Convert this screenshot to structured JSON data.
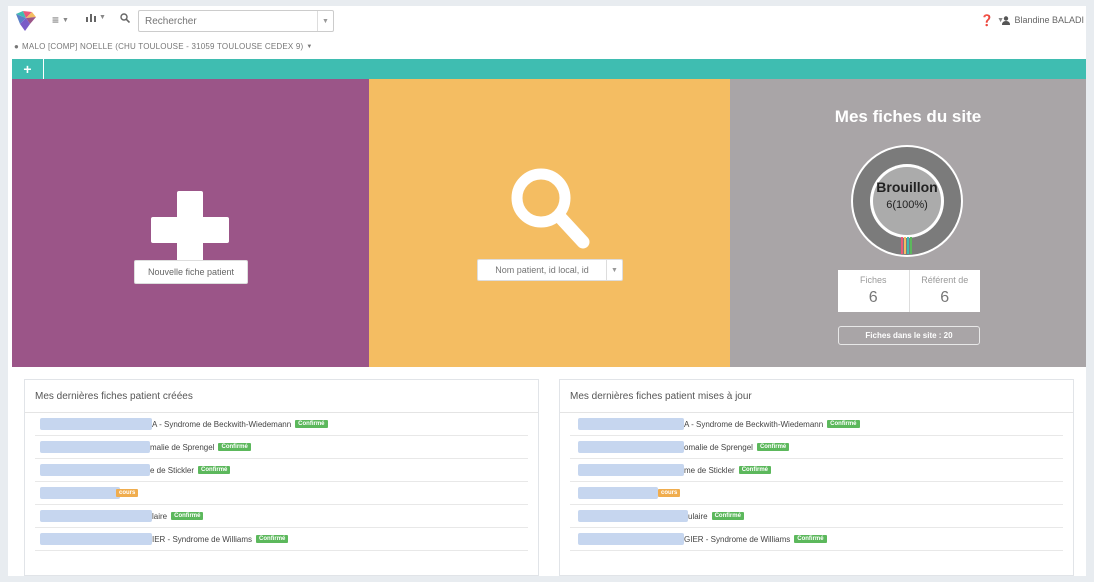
{
  "topbar": {
    "search_placeholder": "Rechercher",
    "user_name": "Blandine BALADI"
  },
  "site": {
    "label": "MALO [COMP] NOELLE (CHU TOULOUSE - 31059 TOULOUSE CEDEX 9)"
  },
  "tiles": {
    "new_patient_label": "Nouvelle fiche patient",
    "patient_search_placeholder": "Nom patient, id local, id",
    "site_stats": {
      "title": "Mes fiches du site",
      "donut_label": "Brouillon",
      "donut_value": "6(100%)",
      "fiches_label": "Fiches",
      "fiches_value": "6",
      "referent_label": "Référent de",
      "referent_value": "6",
      "site_count_label": "Fiches dans le site : 20"
    }
  },
  "panels": {
    "created": {
      "title": "Mes dernières fiches patient créées",
      "rows": [
        {
          "text": "A - Syndrome de Beckwith-Wiedemann",
          "badge": "Confirmé"
        },
        {
          "text": "malie de Sprengel",
          "badge": "Confirmé"
        },
        {
          "text": "e de Stickler",
          "badge": "Confirmé"
        },
        {
          "text": "",
          "badge": "cours"
        },
        {
          "text": "laire",
          "badge": "Confirmé"
        },
        {
          "text": "IER - Syndrome de Williams",
          "badge": "Confirmé"
        }
      ]
    },
    "updated": {
      "title": "Mes dernières fiches patient mises à jour",
      "rows": [
        {
          "text": "A - Syndrome de Beckwith-Wiedemann",
          "badge": "Confirmé"
        },
        {
          "text": "omalie de Sprengel",
          "badge": "Confirmé"
        },
        {
          "text": "me de Stickler",
          "badge": "Confirmé"
        },
        {
          "text": "",
          "badge": "cours"
        },
        {
          "text": "ulaire",
          "badge": "Confirmé"
        },
        {
          "text": "GIER - Syndrome de Williams",
          "badge": "Confirmé"
        }
      ]
    }
  },
  "colors": {
    "teal": "#3fbdb1",
    "purple": "#9b5588",
    "yellow": "#f4bd62",
    "gray": "#a9a5a7",
    "confirmed_green": "#5cb85c",
    "in_progress_orange": "#f0ad4e"
  }
}
